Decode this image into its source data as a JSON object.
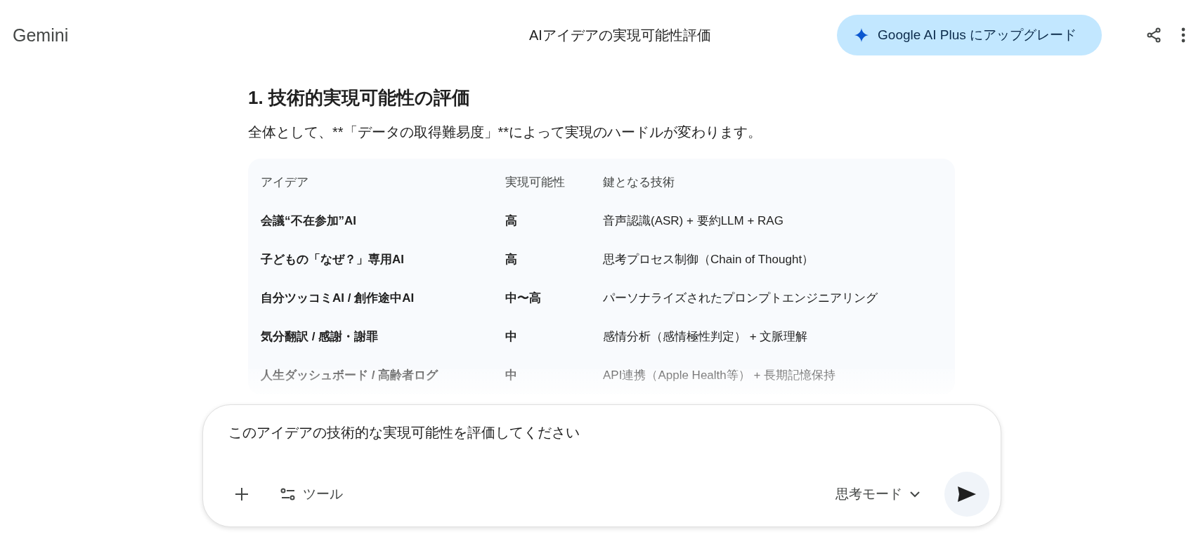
{
  "header": {
    "logo": "Gemini",
    "title": "AIアイデアの実現可能性評価",
    "upgrade_button": "Google AI Plus にアップグレード"
  },
  "response": {
    "heading": "1. 技術的実現可能性の評価",
    "paragraph": "全体として、**「データの取得難易度」**によって実現のハードルが変わります。",
    "table": {
      "columns": [
        "アイデア",
        "実現可能性",
        "鍵となる技術"
      ],
      "rows": [
        [
          "会議“不在参加”AI",
          "高",
          "音声認識(ASR) + 要約LLM + RAG"
        ],
        [
          "子どもの「なぜ？」専用AI",
          "高",
          "思考プロセス制御（Chain of Thought）"
        ],
        [
          "自分ツッコミAI / 創作途中AI",
          "中〜高",
          "パーソナライズされたプロンプトエンジニアリング"
        ],
        [
          "気分翻訳 / 感謝・謝罪",
          "中",
          "感情分析（感情極性判定） + 文脈理解"
        ],
        [
          "人生ダッシュボード / 高齢者ログ",
          "中",
          "API連携（Apple Health等） + 長期記憶保持"
        ]
      ]
    }
  },
  "prompt": {
    "value": "このアイデアの技術的な実現可能性を評価してください",
    "tools_button": "ツール",
    "mode_button": "思考モード"
  }
}
